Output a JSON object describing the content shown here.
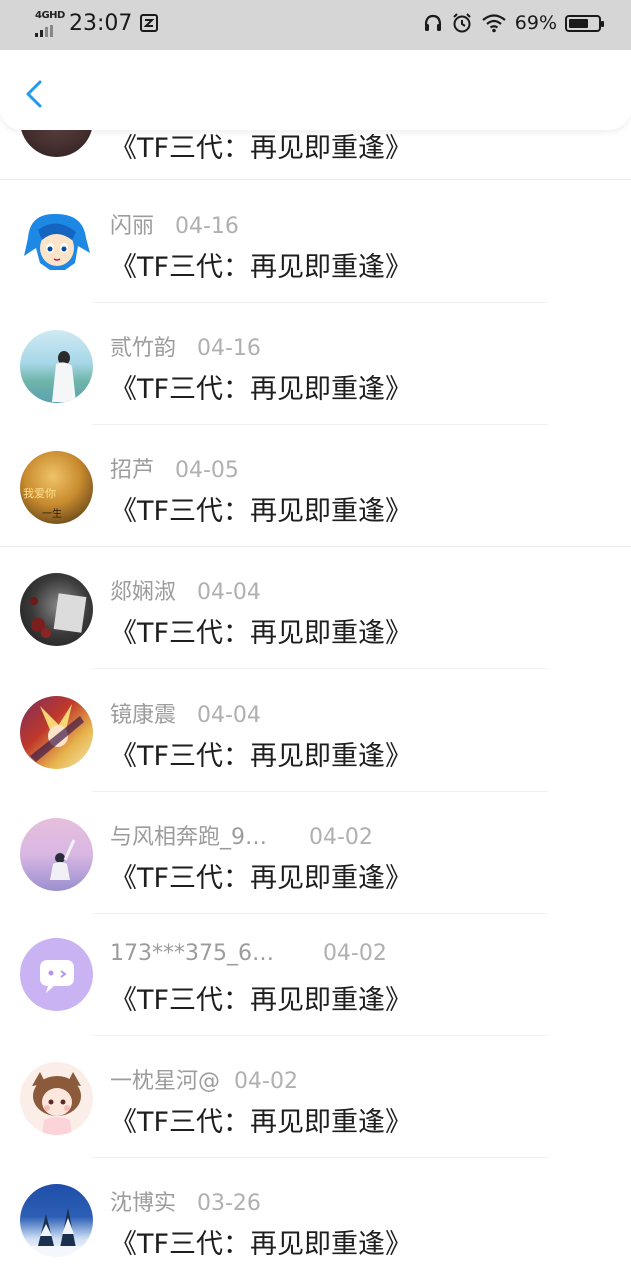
{
  "status_bar": {
    "network": "4GHD",
    "time": "23:07",
    "battery_percent": "69%",
    "battery_level": 0.69,
    "icons": [
      "signal-icon",
      "notification-icon",
      "headphones-icon",
      "alarm-icon",
      "wifi-icon",
      "battery-icon"
    ]
  },
  "nav": {
    "back_icon": "chevron-left-icon",
    "accent_color": "#1e9bf0"
  },
  "list": {
    "items": [
      {
        "name": "",
        "date": "",
        "title": "《TF三代：再见即重逢》",
        "avatar_colors": [
          "#3a2a2a",
          "#6b4a4a"
        ]
      },
      {
        "name": "闪丽",
        "date": "04-16",
        "title": "《TF三代：再见即重逢》",
        "avatar_colors": [
          "#ffffff",
          "#1e88e5"
        ]
      },
      {
        "name": "贰竹韵",
        "date": "04-16",
        "title": "《TF三代：再见即重逢》",
        "avatar_colors": [
          "#a7d7e8",
          "#6fb5a9"
        ]
      },
      {
        "name": "招芦",
        "date": "04-05",
        "title": "《TF三代：再见即重逢》",
        "avatar_colors": [
          "#c98b2e",
          "#3b2a14"
        ]
      },
      {
        "name": "郯娴淑",
        "date": "04-04",
        "title": "《TF三代：再见即重逢》",
        "avatar_colors": [
          "#5a2626",
          "#1f1f1f"
        ]
      },
      {
        "name": "镜康震",
        "date": "04-04",
        "title": "《TF三代：再见即重逢》",
        "avatar_colors": [
          "#7a2d5c",
          "#e7b54c"
        ]
      },
      {
        "name": "与风相奔跑_9…",
        "date": "04-02",
        "title": "《TF三代：再见即重逢》",
        "avatar_colors": [
          "#e7bfdc",
          "#9b8fcf"
        ]
      },
      {
        "name": "173***375_6…",
        "date": "04-02",
        "title": "《TF三代：再见即重逢》",
        "avatar_colors": [
          "#cbb3f5",
          "#b395ef"
        ]
      },
      {
        "name": "一枕星河@",
        "date": "04-02",
        "title": "《TF三代：再见即重逢》",
        "avatar_colors": [
          "#fbeee8",
          "#8a5a3a"
        ]
      },
      {
        "name": "沈博实",
        "date": "03-26",
        "title": "《TF三代：再见即重逢》",
        "avatar_colors": [
          "#2c5fb5",
          "#e9f1fb"
        ]
      }
    ]
  }
}
